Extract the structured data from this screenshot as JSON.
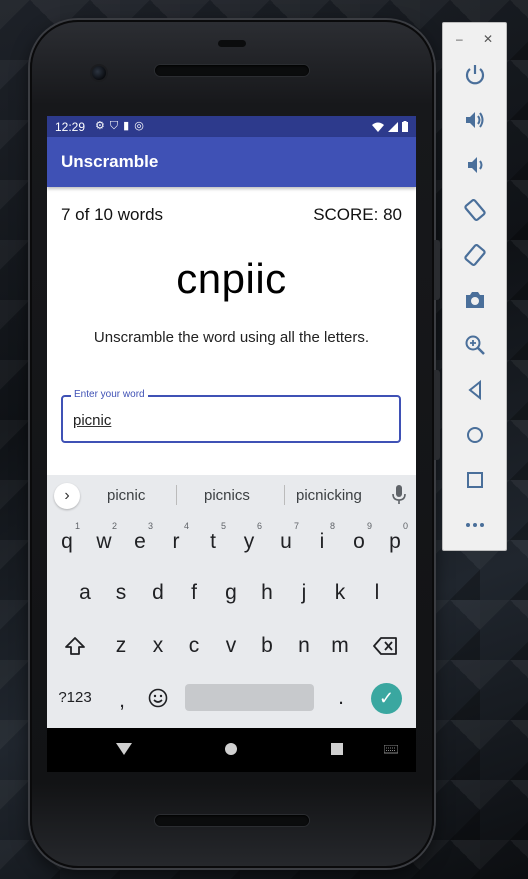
{
  "status_bar": {
    "time": "12:29",
    "icons": [
      "settings-icon",
      "shield-icon",
      "sd-card-icon",
      "data-saver-icon"
    ],
    "right_icons": [
      "wifi-icon",
      "signal-icon",
      "battery-icon"
    ]
  },
  "app_bar": {
    "title": "Unscramble"
  },
  "game": {
    "word_count": "7 of 10 words",
    "score": "SCORE: 80",
    "scrambled_word": "cnpiic",
    "instructions": "Unscramble the word using all the letters.",
    "input_label": "Enter your word",
    "input_value": "picnic"
  },
  "keyboard": {
    "suggestions": [
      "picnic",
      "picnics",
      "picnicking"
    ],
    "row1": [
      {
        "key": "q",
        "num": "1"
      },
      {
        "key": "w",
        "num": "2"
      },
      {
        "key": "e",
        "num": "3"
      },
      {
        "key": "r",
        "num": "4"
      },
      {
        "key": "t",
        "num": "5"
      },
      {
        "key": "y",
        "num": "6"
      },
      {
        "key": "u",
        "num": "7"
      },
      {
        "key": "i",
        "num": "8"
      },
      {
        "key": "o",
        "num": "9"
      },
      {
        "key": "p",
        "num": "0"
      }
    ],
    "row2": [
      "a",
      "s",
      "d",
      "f",
      "g",
      "h",
      "j",
      "k",
      "l"
    ],
    "row3": [
      "z",
      "x",
      "c",
      "v",
      "b",
      "n",
      "m"
    ],
    "symbols_key": "?123",
    "comma_key": ",",
    "period_key": ".",
    "emoji_icon": "emoji-icon",
    "shift_icon": "shift-icon",
    "backspace_icon": "backspace-icon",
    "enter_icon": "check-icon"
  },
  "nav_bar": [
    "back-icon",
    "home-icon",
    "recents-icon",
    "keyboard-switch-icon"
  ],
  "emulator_toolbar": {
    "window_controls": [
      "minimize-icon",
      "close-icon"
    ],
    "buttons": [
      "power-icon",
      "volume-up-icon",
      "volume-down-icon",
      "rotate-left-icon",
      "rotate-right-icon",
      "camera-icon",
      "zoom-icon",
      "back-icon",
      "home-icon",
      "overview-icon",
      "more-icon"
    ]
  },
  "colors": {
    "primary": "#3f51b5",
    "primary_dark": "#2d3a8c",
    "accent": "#3aa7a0",
    "keyboard_bg": "#e8eaed"
  }
}
